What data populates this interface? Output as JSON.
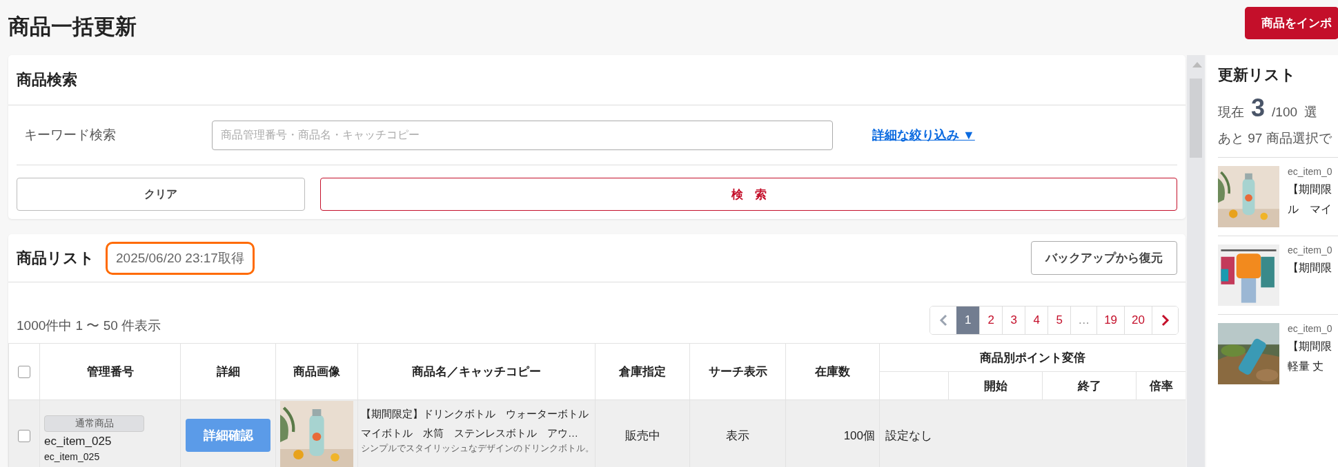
{
  "page_title": "商品一括更新",
  "import_button": "商品をインポ",
  "search_panel": {
    "title": "商品検索",
    "keyword_field": {
      "label": "キーワード検索",
      "placeholder": "商品管理番号・商品名・キャッチコピー"
    },
    "advanced_link": "詳細な絞り込み ▼",
    "clear_button": "クリア",
    "search_button": "検　索"
  },
  "product_list": {
    "title": "商品リスト",
    "fetched_at": "2025/06/20 23:17取得",
    "fetched_at_highlighted": true,
    "restore_button": "バックアップから復元",
    "count_text": "1000件中 1 〜 50 件表示",
    "pagination": {
      "prev_disabled": true,
      "next_disabled": false,
      "pages": [
        {
          "label": "1",
          "selected": true
        },
        {
          "label": "2",
          "selected": false
        },
        {
          "label": "3",
          "selected": false
        },
        {
          "label": "4",
          "selected": false
        },
        {
          "label": "5",
          "selected": false
        },
        {
          "label": "…",
          "selected": false
        },
        {
          "label": "19",
          "selected": false
        },
        {
          "label": "20",
          "selected": false
        }
      ]
    },
    "table": {
      "select_all_checked": false,
      "columns": [
        "管理番号",
        "詳細",
        "商品画像",
        "商品名／キャッチコピー",
        "倉庫指定",
        "サーチ表示",
        "在庫数"
      ],
      "point_group": {
        "title": "商品別ポイント変倍",
        "columns": [
          "開始",
          "終了",
          "倍率"
        ]
      },
      "rows": [
        {
          "checked": false,
          "badge": "通常商品",
          "item_code": "ec_item_025",
          "sub_code": "ec_item_025",
          "detail_button": "詳細確認",
          "name": "【期間限定】ドリンクボトル　ウォーターボトルマイボトル　水筒　ステンレスボトル　アウ…",
          "catch_copy": "シンプルでスタイリッシュなデザインのドリンクボトル。",
          "warehouse": "販売中",
          "search_display": "表示",
          "stock": "100個",
          "point_setting": "設定なし"
        }
      ]
    }
  },
  "update_list": {
    "title": "更新リスト",
    "current_label": "現在",
    "current_count": "3",
    "limit": "/100",
    "tail": "選",
    "remaining": "あと 97 商品選択で",
    "items": [
      {
        "code": "ec_item_0",
        "lines": [
          "【期間限",
          "ル　マイ"
        ]
      },
      {
        "code": "ec_item_0",
        "lines": [
          "【期間限"
        ]
      },
      {
        "code": "ec_item_0",
        "lines": [
          "【期間限",
          "軽量 丈"
        ]
      }
    ]
  }
}
